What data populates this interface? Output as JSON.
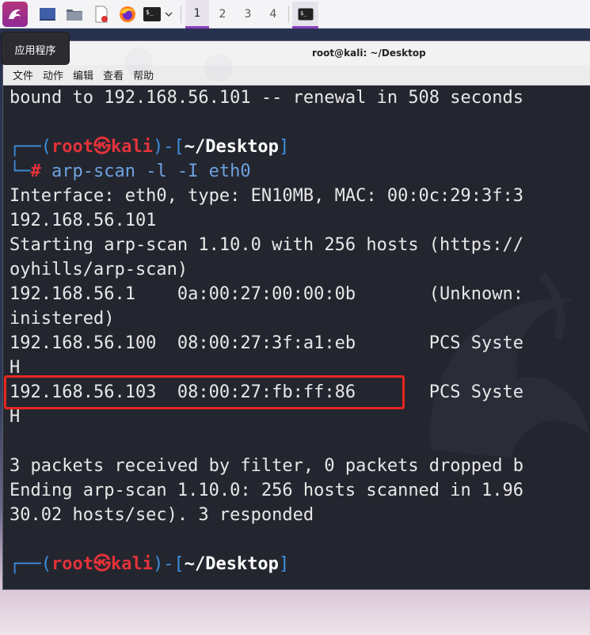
{
  "taskbar": {
    "workspaces": [
      "1",
      "2",
      "3",
      "4"
    ],
    "active_workspace": "1",
    "accent": "#8a3fc2"
  },
  "tooltip": {
    "text": "应用程序"
  },
  "window": {
    "title": "root@kali: ~/Desktop",
    "menu": [
      "文件",
      "动作",
      "编辑",
      "查看",
      "帮助"
    ]
  },
  "terminal": {
    "lines": [
      "bound to 192.168.56.101 -- renewal in 508 seconds",
      "",
      "",
      "",
      "Interface: eth0, type: EN10MB, MAC: 00:0c:29:3f:3",
      "192.168.56.101",
      "Starting arp-scan 1.10.0 with 256 hosts (https://",
      "oyhills/arp-scan)",
      "192.168.56.1    0a:00:27:00:00:0b       (Unknown:",
      "inistered)",
      "192.168.56.100  08:00:27:3f:a1:eb       PCS Syste",
      "H",
      "192.168.56.103  08:00:27:fb:ff:86       PCS Syste",
      "H",
      "",
      "3 packets received by filter, 0 packets dropped b",
      "Ending arp-scan 1.10.0: 256 hosts scanned in 1.96",
      "30.02 hosts/sec). 3 responded"
    ],
    "prompt": {
      "corner_top": "┌──(",
      "user": "root",
      "at": "㉿",
      "host": "kali",
      "mid": ")-[",
      "path": "~/Desktop",
      "close": "]",
      "corner_bottom": "└─",
      "hash": "#"
    },
    "command": "arp-scan -l -I eth0",
    "colors": {
      "prompt_frame": "#3c8fe0",
      "user_host": "#e3323a",
      "highlight_box": "#e8261f"
    }
  }
}
